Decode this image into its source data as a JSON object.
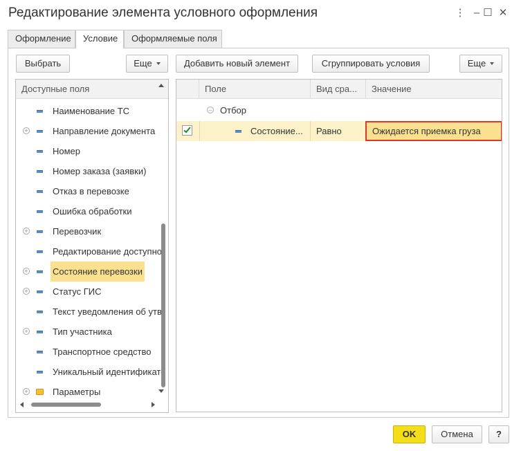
{
  "window": {
    "title": "Редактирование элемента условного оформления",
    "more_icon": "⋮",
    "minimize_icon": "–",
    "maximize_icon": "☐",
    "close_icon": "✕"
  },
  "tabs": [
    {
      "label": "Оформление",
      "active": false
    },
    {
      "label": "Условие",
      "active": true
    },
    {
      "label": "Оформляемые поля",
      "active": false
    }
  ],
  "left_toolbar": {
    "select_label": "Выбрать",
    "more_label": "Еще"
  },
  "fields_tree": {
    "header": "Доступные поля",
    "items": [
      {
        "label": "Наименование ТС",
        "expandable": false,
        "icon": "field-icon"
      },
      {
        "label": "Направление документа",
        "expandable": true,
        "icon": "field-icon"
      },
      {
        "label": "Номер",
        "expandable": false,
        "icon": "field-icon"
      },
      {
        "label": "Номер заказа (заявки)",
        "expandable": false,
        "icon": "field-icon"
      },
      {
        "label": "Отказ в перевозке",
        "expandable": false,
        "icon": "field-icon"
      },
      {
        "label": "Ошибка обработки",
        "expandable": false,
        "icon": "field-icon"
      },
      {
        "label": "Перевозчик",
        "expandable": true,
        "icon": "field-icon"
      },
      {
        "label": "Редактирование доступно",
        "expandable": false,
        "icon": "field-icon"
      },
      {
        "label": "Состояние перевозки",
        "expandable": true,
        "icon": "field-icon",
        "selected": true
      },
      {
        "label": "Статус ГИС",
        "expandable": true,
        "icon": "field-icon"
      },
      {
        "label": "Текст уведомления об утв",
        "expandable": false,
        "icon": "field-icon"
      },
      {
        "label": "Тип участника",
        "expandable": true,
        "icon": "field-icon"
      },
      {
        "label": "Транспортное средство",
        "expandable": false,
        "icon": "field-icon"
      },
      {
        "label": "Уникальный идентификато",
        "expandable": false,
        "icon": "field-icon"
      },
      {
        "label": "Параметры",
        "expandable": true,
        "icon": "folder-icon"
      }
    ]
  },
  "right_toolbar": {
    "add_label": "Добавить новый элемент",
    "group_label": "Сгруппировать условия",
    "more_label": "Еще"
  },
  "conditions": {
    "columns": [
      "Поле",
      "Вид сра...",
      "Значение"
    ],
    "group_label": "Отбор",
    "row": {
      "checked": true,
      "field": "Состояние...",
      "comparison": "Равно",
      "value": "Ожидается приемка груза"
    }
  },
  "footer": {
    "ok_label": "OK",
    "cancel_label": "Отмена",
    "help_label": "?"
  },
  "colors": {
    "selection": "#fbe18f",
    "ok_button": "#f5dd1a",
    "highlight_border": "#e0352b"
  }
}
